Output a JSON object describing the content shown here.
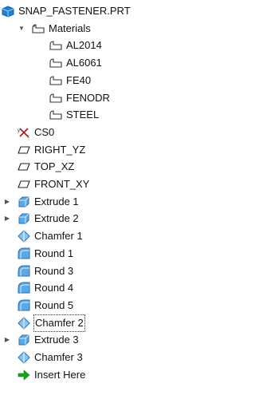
{
  "tree": {
    "root": {
      "label": "SNAP_FASTENER.PRT",
      "icon": "part-icon"
    },
    "materials": {
      "label": "Materials",
      "icon": "material-folder-icon",
      "expanded": true,
      "items": [
        "AL2014",
        "AL6061",
        "FE40",
        "FENODR",
        "STEEL"
      ]
    },
    "features": [
      {
        "label": "CS0",
        "icon": "coordinate-system-icon",
        "expandable": false
      },
      {
        "label": "RIGHT_YZ",
        "icon": "datum-plane-icon",
        "expandable": false
      },
      {
        "label": "TOP_XZ",
        "icon": "datum-plane-icon",
        "expandable": false
      },
      {
        "label": "FRONT_XY",
        "icon": "datum-plane-icon",
        "expandable": false
      },
      {
        "label": "Extrude 1",
        "icon": "extrude-icon",
        "expandable": true
      },
      {
        "label": "Extrude 2",
        "icon": "extrude-icon",
        "expandable": true
      },
      {
        "label": "Chamfer 1",
        "icon": "chamfer-icon",
        "expandable": false
      },
      {
        "label": "Round 1",
        "icon": "round-icon",
        "expandable": false
      },
      {
        "label": "Round 3",
        "icon": "round-icon",
        "expandable": false
      },
      {
        "label": "Round 4",
        "icon": "round-icon",
        "expandable": false
      },
      {
        "label": "Round 5",
        "icon": "round-icon",
        "expandable": false
      },
      {
        "label": "Chamfer 2",
        "icon": "chamfer-icon",
        "expandable": false,
        "selected": true
      },
      {
        "label": "Extrude 3",
        "icon": "extrude-icon",
        "expandable": true
      },
      {
        "label": "Chamfer 3",
        "icon": "chamfer-icon",
        "expandable": false
      },
      {
        "label": "Insert Here",
        "icon": "insert-arrow-icon",
        "expandable": false
      }
    ]
  },
  "colors": {
    "part_blue": "#1f7fd0",
    "solid_blue": "#5aa8e6",
    "insert_green": "#1aa01a"
  }
}
